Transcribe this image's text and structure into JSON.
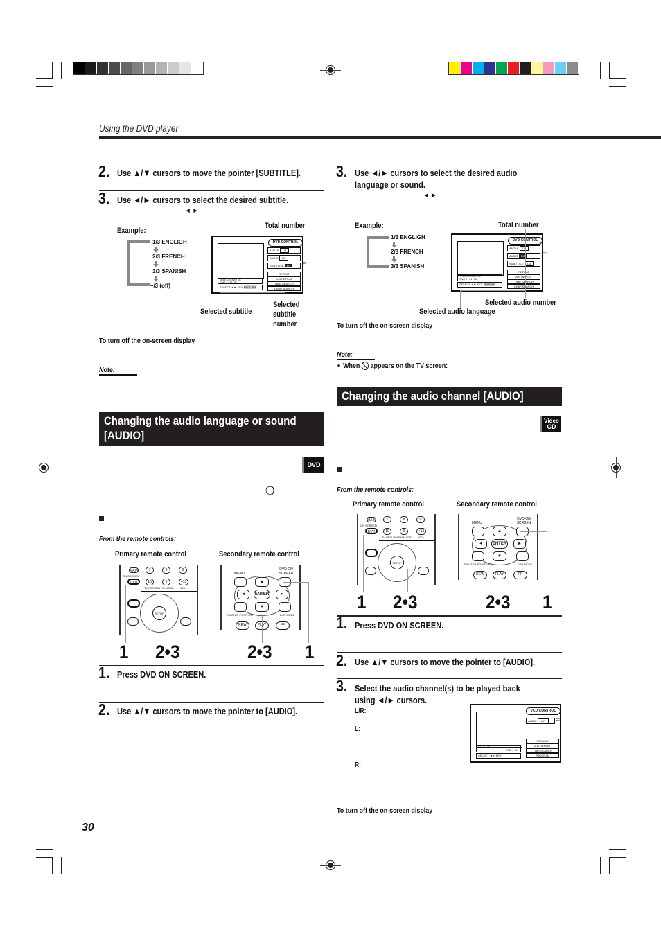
{
  "page": {
    "header": "Using the DVD player",
    "page_number": "30"
  },
  "color_bars": {
    "gray": [
      "#000000",
      "#1a1a1a",
      "#333333",
      "#4d4d4d",
      "#666666",
      "#808080",
      "#999999",
      "#b3b3b3",
      "#cccccc",
      "#e6e6e6",
      "#ffffff"
    ],
    "color": [
      "#fff200",
      "#ec008c",
      "#00aeef",
      "#2e3192",
      "#00a651",
      "#ed1c24",
      "#231f20",
      "#fff799",
      "#f49ac1",
      "#6dcff6",
      "#8c8c8c"
    ]
  },
  "left": {
    "step2": {
      "num": "2.",
      "text": "Use ▲/▼ cursors to move the pointer [SUBTITLE]."
    },
    "step3": {
      "num": "3.",
      "text": "Use ◄/► cursors to select the desired subtitle.",
      "sub": "◄ ►"
    },
    "example_label": "Example:",
    "total_number": "Total number",
    "example_items": [
      "1/3 ENGLIGH",
      "2/3 FRENCH",
      "3/3 SPANISH",
      "–/3 (off)"
    ],
    "selected_subtitle": "Selected subtitle",
    "selected_subtitle_number": [
      "Selected",
      "subtitle",
      "number"
    ],
    "turn_off": "To turn off the on-screen display",
    "note": "Note:",
    "osd": {
      "title": "DVD CONTROL",
      "rows": [
        {
          "label": "ANGLE",
          "value": "1/3"
        },
        {
          "label": "AUDIO",
          "value": "1/3"
        },
        {
          "label": "SUB-TITLE",
          "value": "1/3"
        }
      ],
      "buttons": [
        "REPEAT",
        "A-B REPEAT",
        "TIME SEARCH",
        "CHAP.SEARCH"
      ],
      "title_info": "TITLE 03  CHAP. 03",
      "time_info": "TIME  2 : 34 : 56",
      "select_key": "SELECT ◄► KEY",
      "selected_value": "ENGLISH"
    },
    "section_title": "Changing the audio language or sound [AUDIO]",
    "badge": "DVD",
    "from_remote": "From the remote controls:",
    "primary_label": "Primary remote control",
    "secondary_label": "Secondary remote control",
    "callouts": [
      "1",
      "2•3",
      "2•3",
      "1"
    ],
    "step1b": {
      "num": "1.",
      "text": "Press DVD ON SCREEN."
    },
    "step2b": {
      "num": "2.",
      "text": "Use ▲/▼ cursors to move the pointer to [AUDIO]."
    }
  },
  "right": {
    "step3": {
      "num": "3.",
      "text_line1": "Use ◄/► cursors to select the desired audio",
      "text_line2": "language or sound.",
      "sub": "◄ ►"
    },
    "example_label": "Example:",
    "total_number": "Total number",
    "example_items": [
      "1/3 ENGLIGH",
      "2/3 FRENCH",
      "3/3 SPANISH"
    ],
    "selected_audio_number": "Selected audio number",
    "selected_audio_language": "Selected audio language",
    "turn_off": "To turn off the on-screen display",
    "note": "Note:",
    "note_bullet": "When",
    "note_rest": "appears on the TV screen:",
    "osd": {
      "title": "DVD CONTROL",
      "rows": [
        {
          "label": "ANGLE",
          "value": "1/3"
        },
        {
          "label": "AUDIO",
          "value": "1/3"
        },
        {
          "label": "SUB-TITLE",
          "value": "1/3"
        }
      ],
      "buttons": [
        "REPEAT",
        "A-B REPEAT",
        "TIME SEARCH",
        "CHAP.SEARCH"
      ],
      "title_info": "TITLE 03  CHAP. 03",
      "time_info": "TIME  2 : 34 : 56",
      "select_key": "SELECT ◄► KEY",
      "selected_value": "ENGLISH"
    },
    "section_title": "Changing the audio channel [AUDIO]",
    "badge_line1": "Video",
    "badge_line2": "CD",
    "from_remote": "From the remote controls:",
    "primary_label": "Primary remote control",
    "secondary_label": "Secondary remote control",
    "callouts": [
      "1",
      "2•3",
      "2•3",
      "1"
    ],
    "step1": {
      "num": "1.",
      "text": "Press DVD ON SCREEN."
    },
    "step2": {
      "num": "2.",
      "text": "Use ▲/▼ cursors to move the pointer to [AUDIO]."
    },
    "step3b": {
      "num": "3.",
      "text_line1": "Select the audio channel(s) to be played back",
      "text_line2": "using ◄/► cursors."
    },
    "channels": [
      "L/R:",
      "L:",
      "R:"
    ],
    "vcd_osd": {
      "title": "VCD CONTROL",
      "row_label": "AUDIO",
      "row_value": "L/R",
      "buttons": [
        "RESUME",
        "A-B REPEAT",
        "TIME SEARCH",
        "PROGRAM"
      ],
      "track_info": "TRACK 03",
      "time_info": "TIME  4 : 04",
      "select_key": "SELECT ◄► KEY"
    },
    "turn_off2": "To turn off the on-screen display"
  },
  "remote_labels": {
    "main": "MAIN",
    "on_screen": "ON SCREEN",
    "dvd": "DVD",
    "n7": "7",
    "n8": "8",
    "n9": "9",
    "n10": "10",
    "n0": "0",
    "n10p": "+10",
    "tv_return": "TV RETURN",
    "fm_mode": "FM MODE",
    "plus100": "100+",
    "menu": "MENU",
    "enter": "ENTER",
    "setup": "SETUP",
    "dvd_on_screen": "DVD ON SCREEN",
    "theater_position": "THEATER POSITION",
    "dsp_mode": "DSP MODE",
    "rew": "REW",
    "play": "PLAY",
    "ff": "FF"
  }
}
